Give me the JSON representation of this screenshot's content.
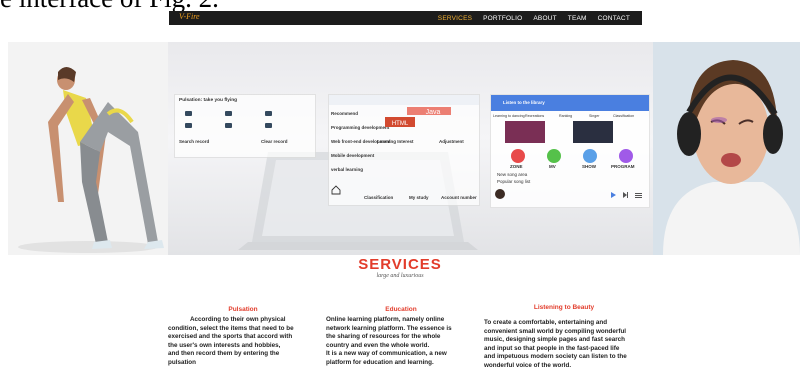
{
  "caption": "e interface of Fig. 2.",
  "navbar": {
    "logo": "V-Fire",
    "items": [
      "SERVICES",
      "PORTFOLIO",
      "ABOUT",
      "TEAM",
      "CONTACT"
    ]
  },
  "hero": {
    "left_panel": {
      "title": "Pulsation: take you flying",
      "search": "Search record",
      "clear": "Clear record"
    },
    "center_panel": {
      "items": [
        "Recommend",
        "Programming development",
        "Web front-end development",
        "Mobile development",
        "verbal learning"
      ],
      "tags": [
        "Learning Interest",
        "Adjustment"
      ],
      "bottom_nav": [
        "Classification",
        "My study",
        "Account number"
      ]
    },
    "right_panel": {
      "header": "Listen to the library",
      "tabs": [
        "Learning to dancing",
        "Recreations",
        "Ranking",
        "Singer",
        "Classification"
      ],
      "buttons": [
        "ZONE",
        "MV",
        "SHOW",
        "PROGRAM"
      ],
      "list": [
        "New song area",
        "Popular song list"
      ]
    }
  },
  "services": {
    "title": "SERVICES",
    "subtitle": "large and luxurious",
    "columns": [
      {
        "title": "Pulsation",
        "lines": [
          "According to their own physical",
          "condition, select the items that need to be",
          "exercised and the sports that accord with",
          "the user's own interests and hobbies,",
          "and then record them by entering the",
          "pulsation"
        ]
      },
      {
        "title": "Education",
        "lines": [
          "Online learning platform, namely online",
          "network learning platform. The essence is",
          "the sharing of resources for the whole",
          "country and even the whole world.",
          "It is a new way of communication, a new",
          "platform for education and learning."
        ]
      },
      {
        "title": "Listening to Beauty",
        "lines": [
          "To create a comfortable, entertaining and",
          "convenient small world by compiling wonderful",
          "music, designing simple pages and fast search",
          "and input so that people in the fast-paced life",
          "and impetuous modern society can listen to the",
          "wonderful voice of the world."
        ]
      }
    ]
  },
  "colors": {
    "accent_red": "#e23c2b",
    "nav_active": "#f2b134",
    "navbar_bg": "#1c1c1c"
  }
}
